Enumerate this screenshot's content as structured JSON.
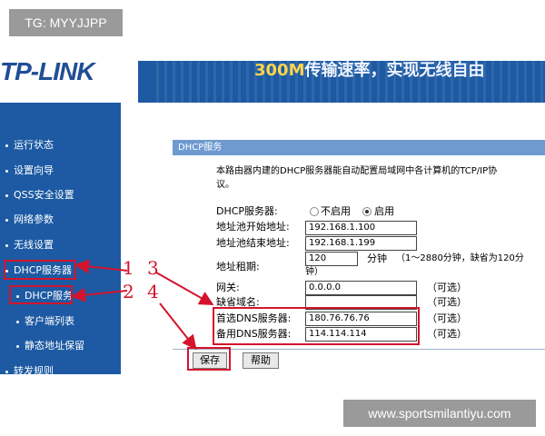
{
  "watermark_top": "TG: MYYJJPP",
  "watermark_bottom": "www.sportsmilantiyu.com",
  "brand": {
    "logo": "TP-LINK",
    "banner_highlight": "300M",
    "banner_text": "传输速率，实现无线自由"
  },
  "sidebar": {
    "items": [
      {
        "label": "运行状态"
      },
      {
        "label": "设置向导"
      },
      {
        "label": "QSS安全设置"
      },
      {
        "label": "网络参数"
      },
      {
        "label": "无线设置"
      },
      {
        "label": "DHCP服务器"
      },
      {
        "label": "DHCP服务"
      },
      {
        "label": "客户端列表"
      },
      {
        "label": "静态地址保留"
      },
      {
        "label": "转发规则"
      }
    ]
  },
  "panel": {
    "title": "DHCP服务",
    "intro_line1": "本路由器内建的DHCP服务器能自动配置局域网中各计算机的TCP/IP协",
    "intro_line2": "议。",
    "dhcp_label": "DHCP服务器:",
    "radio_off": "不启用",
    "radio_on": "启用",
    "start_label": "地址池开始地址:",
    "start_value": "192.168.1.100",
    "end_label": "地址池结束地址:",
    "end_value": "192.168.1.199",
    "lease_label": "地址租期:",
    "lease_value": "120",
    "lease_unit": "分钟",
    "lease_hint": "（1～2880分钟，缺省为120分",
    "lease_hint2": "钟）",
    "gateway_label": "网关:",
    "gateway_value": "0.0.0.0",
    "domain_label": "缺省域名:",
    "domain_value": "",
    "dns1_label": "首选DNS服务器:",
    "dns1_value": "180.76.76.76",
    "dns2_label": "备用DNS服务器:",
    "dns2_value": "114.114.114",
    "optional": "（可选）",
    "save": "保存",
    "help": "帮助"
  },
  "annotations": {
    "n1": "1",
    "n2": "2",
    "n3": "3",
    "n4": "4"
  },
  "colors": {
    "nav_bg": "#1d5aa3",
    "highlight": "#d4142c",
    "panel_head": "#6e9ad0"
  }
}
